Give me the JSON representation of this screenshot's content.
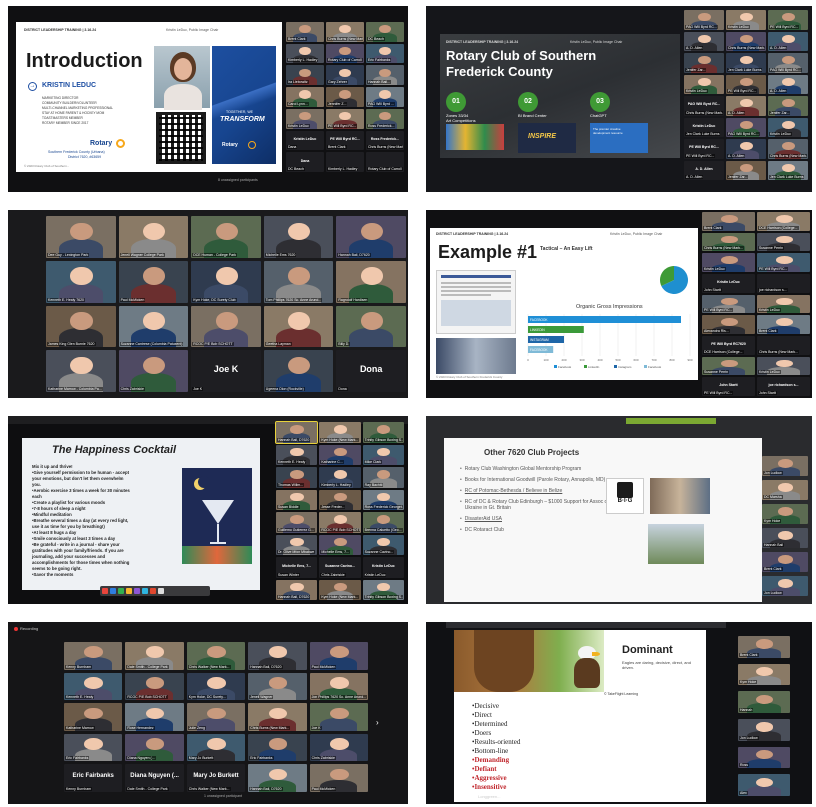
{
  "p1": {
    "header_left": "DISTRICT LEADERSHIP TRAINING | 3.16.24",
    "header_right": "Kristin LeDuc, Public Image Chair",
    "title": "Introduction",
    "name": "KRISTIN LEDUC",
    "bullets": [
      "MARKETING DIRECTOR",
      "COMMUNITY BUILDER/VOLUNTEER",
      "MULTI-CHANNEL MARKETING PROFESSIONAL",
      "STAY AT HOME PARENT & HOCKEY MOM",
      "TOASTMASTERS MEMBER",
      "ROTARY MEMBER SINCE 2017"
    ],
    "rotary": "Rotary",
    "club": "Southern Frederick County (Urbana)",
    "district": "District 7620, #63659",
    "poster_1": "TOGETHER, WE",
    "poster_2": "TRANSFORM",
    "poster_3": "Rotary",
    "footer": "© 2023 Rotary Club of Southern...",
    "participants": "8 unassigned participants",
    "names": [
      "Brent Clark",
      "Chris Burns (New Mark...",
      "DC Beach",
      "Kimberly L. Hadley",
      "Rotary Club of Carroll",
      "Eric Fairbanks",
      "Ira Liebowitz",
      "Gary Zehrer",
      "Hannah Bail...",
      "Carol Lynn...",
      "Jennifer Z...",
      "PAG Will Byrd ...",
      "Kristin LeDuc",
      "PE Will Byrd RC...",
      "Ross Frederick...",
      "Dana"
    ],
    "name_kristin": "Kristin LeDuc",
    "name_pe": "PE Will Byrd RC...",
    "name_ross": "Ross Frederick...",
    "name_dana": "Dana",
    "name_pag": "PAG Will Byrd RC..."
  },
  "p2": {
    "header_left": "DISTRICT LEADERSHIP TRAINING | 3.16.24",
    "header_right": "Kristin LeDuc, Public Image Chair",
    "title1": "Rotary Club of Southern",
    "title2": "Frederick County",
    "items": [
      {
        "num": "01",
        "l1": "Zones 33/34",
        "l2": "Art Competitions"
      },
      {
        "num": "02",
        "l1": "BI Brand Center",
        "l2": ""
      },
      {
        "num": "03",
        "l1": "ChatGPT",
        "l2": ""
      }
    ],
    "inspire": "INSPIRE",
    "chatgpt_sub": "The premier creative development resource",
    "names": [
      "PAG Will Byrd RC...",
      "Kristin LeDuc",
      "PE Will Byrd RC...",
      "A. D. Allen",
      "Chris Burns (New Mark...",
      "A. D. Allen",
      "Jenifer Zar...",
      "Jen Clark Luke Burns"
    ],
    "pag": "PAG Will Byrd RC...",
    "kristin": "Kristin LeDuc",
    "pe": "PE Will Byrd RC...",
    "allen": "A. D. Allen"
  },
  "p3": {
    "names": [
      "Dee Guy - Lexington Park",
      "Jenell Wagner College Park",
      "DCE Human - College Park",
      "Michelle Ems 7620",
      "Hannah Bail, D7620",
      "Kenneth E. Healy 7620",
      "Paul McMicken",
      "Kym Hoke, DC Surety Club",
      "Tom Phillips 7620 Sc. Anne Arund...",
      "Ragndolf Hardisen",
      "James King Glen Burnie 7620",
      "Suzanne Cantrese (Columbia Patuxent)",
      "RCOC P/E Bob SCHOTT",
      "Geetha Layman",
      "Billy D.",
      "Katharine Marrow - Columbia Pa...",
      "Chris Zabriskie",
      "Joe K",
      "Ugeena Olon (Rockville)",
      "Dona"
    ],
    "joe": "Joe K",
    "dona": "Dona",
    "magic": "MAGIC"
  },
  "p4": {
    "header_left": "DISTRICT LEADERSHIP TRAINING | 3.16.24",
    "header_right": "Kristin LeDuc, Public Image Chair",
    "title": "Example #1",
    "subtitle": "Tactical – An Easy Lift",
    "chart_title": "Organic Gross Impressions",
    "legend": [
      "Facebook",
      "LinkedIn",
      "Instagram",
      "Facebook"
    ],
    "names": [
      "Brent Clark",
      "DCE Harrison (College...",
      "Chris Burns (New Mark...",
      "Susanne Perrin",
      "Kristin LeDuc",
      "PE Will Byrd RC...",
      "John Startt",
      "joe richardson s...",
      "PE Will Byrd RC...",
      "Kristin LeDuc",
      "Alexandra Ris..."
    ],
    "kristin": "Kristin LeDuc",
    "pe": "PE Will Byrd RC7620",
    "john": "John Startt",
    "joe": "joe richardson s...",
    "footer": "© 2023 Rotary Club of Southern Frederick County"
  },
  "chart_data": {
    "type": "bar",
    "orientation": "horizontal",
    "title": "Organic Gross Impressions",
    "categories": [
      "FACEBOOK",
      "LINKEDIN",
      "INSTAGRAM",
      "FACEBOOK"
    ],
    "values": [
      850,
      310,
      200,
      140
    ],
    "ticks": [
      "0",
      "100",
      "200",
      "300",
      "400",
      "500",
      "600",
      "700",
      "800",
      "900"
    ],
    "xlim": [
      0,
      900
    ],
    "colors": [
      "#1f8fd6",
      "#3b9a3a",
      "#1e66a8",
      "#7fbad7"
    ],
    "pie": {
      "values": [
        68,
        32
      ],
      "colors": [
        "#1e8fd0",
        "#3e9a36"
      ]
    }
  },
  "p5": {
    "title": "The Happiness Cocktail",
    "lines": [
      "Mix it up and thrive!",
      "•Give yourself permission to be human - accept",
      "your emotions, but don't let them overwhelm",
      "you.",
      "•Aerobic exercise 3 times a week for 30 minutes",
      "each",
      "•Create a playlist for various moods",
      "•7-8 hours of sleep a night",
      "•Mindful meditation",
      "•Breathe several times a day (at every red light,",
      "use it as time for you by breathing!)",
      "•At least 8 hugs a day",
      "•Smile consciously at least 3 times a day",
      "•Be grateful - write in a journal - share your",
      "gratitudes with your family/friends. If you are",
      "journaling, add your successes and",
      "accomplishments for those times when nothing",
      "seems to be going right.",
      "•Savor the moments"
    ],
    "names": [
      "Hannah Bail, D7620",
      "Kym Hoke (New Mark...",
      "Trinity Gibson Boxing S...",
      "Kenneth E. Healy",
      "Katharine C...",
      "Mike Clark",
      "Thomas Willm...",
      "Kimberly L. Hadley",
      "Ray Bachiti",
      "Susan Biddle",
      "Jesse Freder...",
      "Ross Frederick Georget...",
      "Guillemo Gutierrez G...",
      "RCOC P/E Bob SCHOTT",
      "Brenna Caluetto (Geo...",
      "Dr. Olive Mfon Mbakwe",
      "Michelle Ems, 7...",
      "Suzanne Cavino...",
      "Susan Winter",
      "Chris Zabriskie",
      "Kristin LeDuc"
    ],
    "michelle": "Michelle Ems, 7...",
    "suzanne": "Suzanne Cavino...",
    "kristin": "Kristin LeDuc",
    "n_letter": "N"
  },
  "p6": {
    "title": "Other 7620 Club Projects",
    "items": [
      "Rotary Club Washington Global Mentorship Program",
      "Books for International Goodwill (Parole Rotary, Annapolis, MD)",
      "RC of Potomac-Bethesda / Believe in Belize",
      "RC of DC & Rotary Club Edinburgh – $1000 Support for Assoc of Ukraine in Gt. Britain",
      "DisasterAid USA",
      "DC Rotaract Club"
    ],
    "big": "B·I·G",
    "names": [
      "Jon Ludlow",
      "DC Marsha",
      "Kym Hoke",
      "Hannah Bail",
      "Brent Clark"
    ],
    "top_bar": "Other 7620 Club Projects"
  },
  "p7": {
    "recording": "Recording",
    "names": [
      "Kenny Burnham",
      "Dale Smith - College Park",
      "Chris Walker (New Mark...",
      "Hannah Bail, D7620",
      "Paul McMicken",
      "Kenneth E. Healy",
      "RCOC P/E Bob SCHOTT",
      "Kym Hoke, DC Surety...",
      "Jenell Wagner",
      "Jon Phillips 7620 Sc. Anne Arund...",
      "Katharine Marrow",
      "Rose Hernandez",
      "Julie Zeng",
      "Chris Burns (New Mark...",
      "Joe K",
      "Eric Fairbanks",
      "Diana Nguyen (...",
      "Mary Jo Burkett",
      "Eric Fairbanks",
      "Chris Zabriskie"
    ],
    "eric": "Eric Fairbanks",
    "diana": "Diana Nguyen (...",
    "mary": "Mary Jo Burkett",
    "unassigned": "1 unassigned participant",
    "magic": "MAGIC"
  },
  "p8": {
    "title": "Dominant",
    "desc": "Eagles are daring, decisive, direct, and driven.",
    "credit": "© TakeFlight Learning",
    "traits": [
      "Decisive",
      "Direct",
      "Determined",
      "Doers",
      "Results-oriented",
      "Bottom-line"
    ],
    "red_traits": [
      "Demanding",
      "Defiant",
      "Aggressive",
      "Insensitive"
    ],
    "longgreen": "Longgreen...",
    "names": [
      "Brent Clark",
      "Kym Hoke",
      "Hannah",
      "Jon Ludlow",
      "Ross",
      "Alex"
    ]
  }
}
